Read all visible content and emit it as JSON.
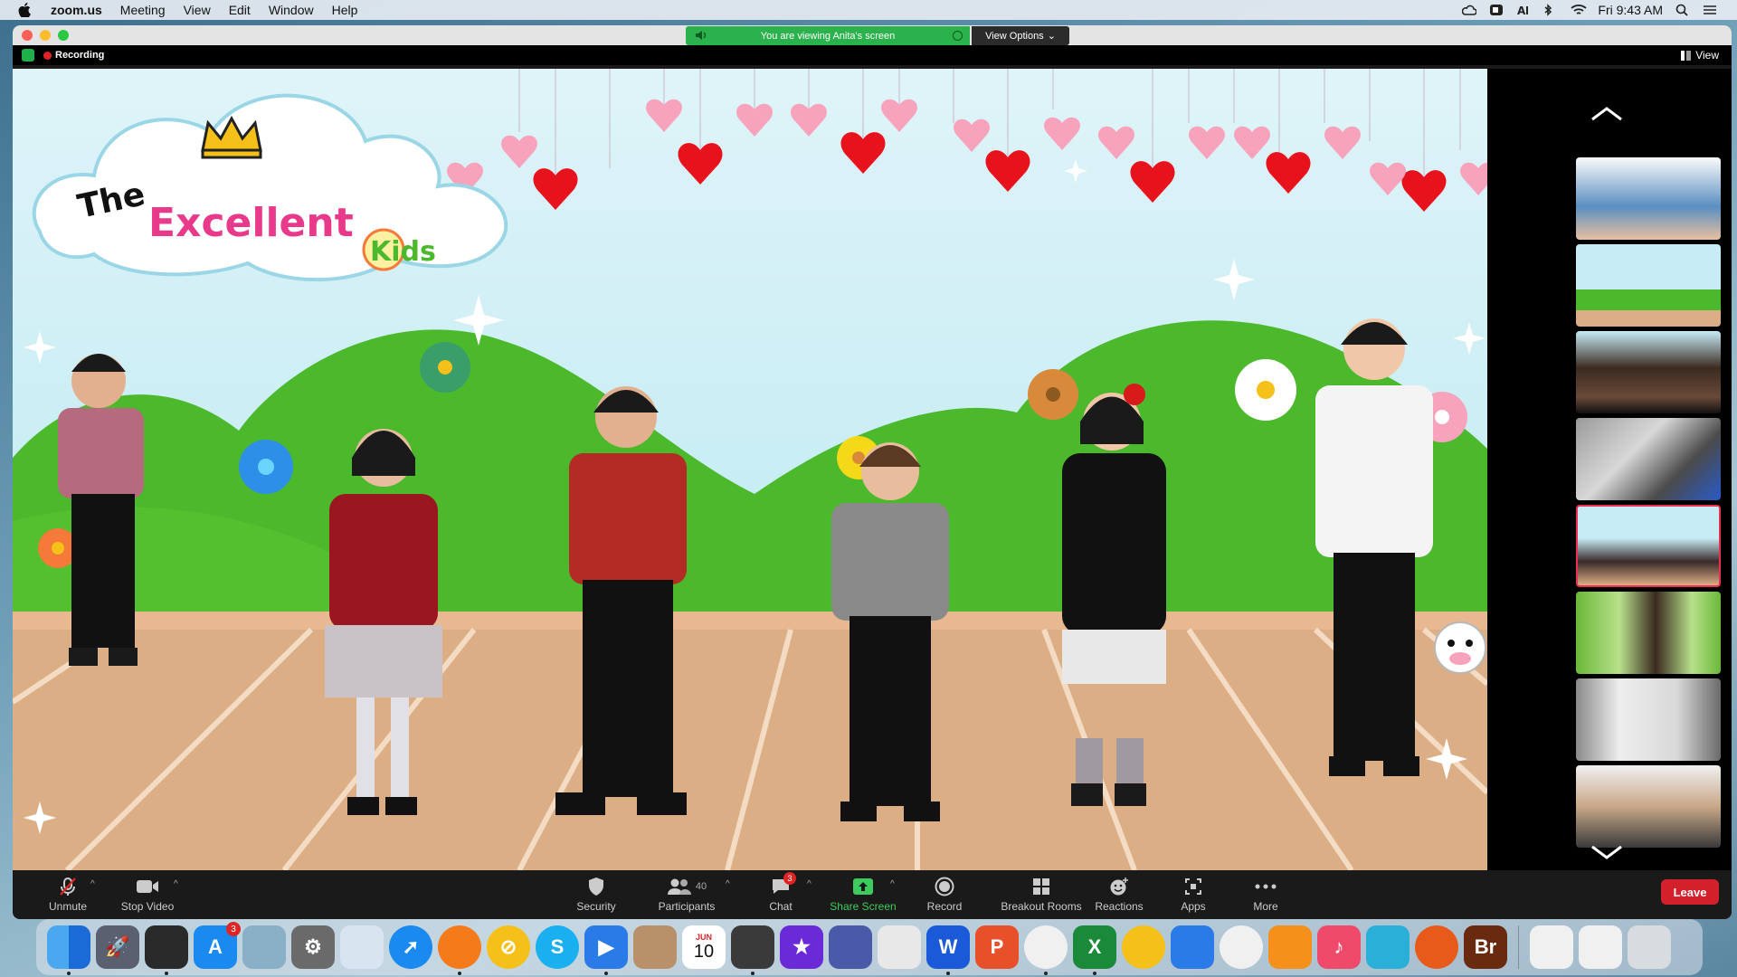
{
  "menubar": {
    "app": "zoom.us",
    "items": [
      "Meeting",
      "View",
      "Edit",
      "Window",
      "Help"
    ],
    "clock": "Fri 9:43 AM"
  },
  "window": {
    "banner": "You are viewing Anita's screen",
    "view_options": "View Options",
    "recording": "Recording",
    "view": "View"
  },
  "share": {
    "title_word1": "The",
    "title_word2": "Excellent",
    "title_word3": "Kids"
  },
  "toolbar": {
    "unmute": "Unmute",
    "stop_video": "Stop Video",
    "security": "Security",
    "participants": "Participants",
    "participants_count": "40",
    "chat": "Chat",
    "chat_badge": "3",
    "share_screen": "Share Screen",
    "record": "Record",
    "breakout": "Breakout Rooms",
    "reactions": "Reactions",
    "apps": "Apps",
    "more": "More",
    "leave": "Leave"
  },
  "dock": {
    "appstore_badge": "3",
    "calendar_month": "JUN",
    "calendar_day": "10"
  },
  "colors": {
    "accent_green": "#2bb24c",
    "leave_red": "#d4202b",
    "hill_green": "#4cb82c"
  }
}
